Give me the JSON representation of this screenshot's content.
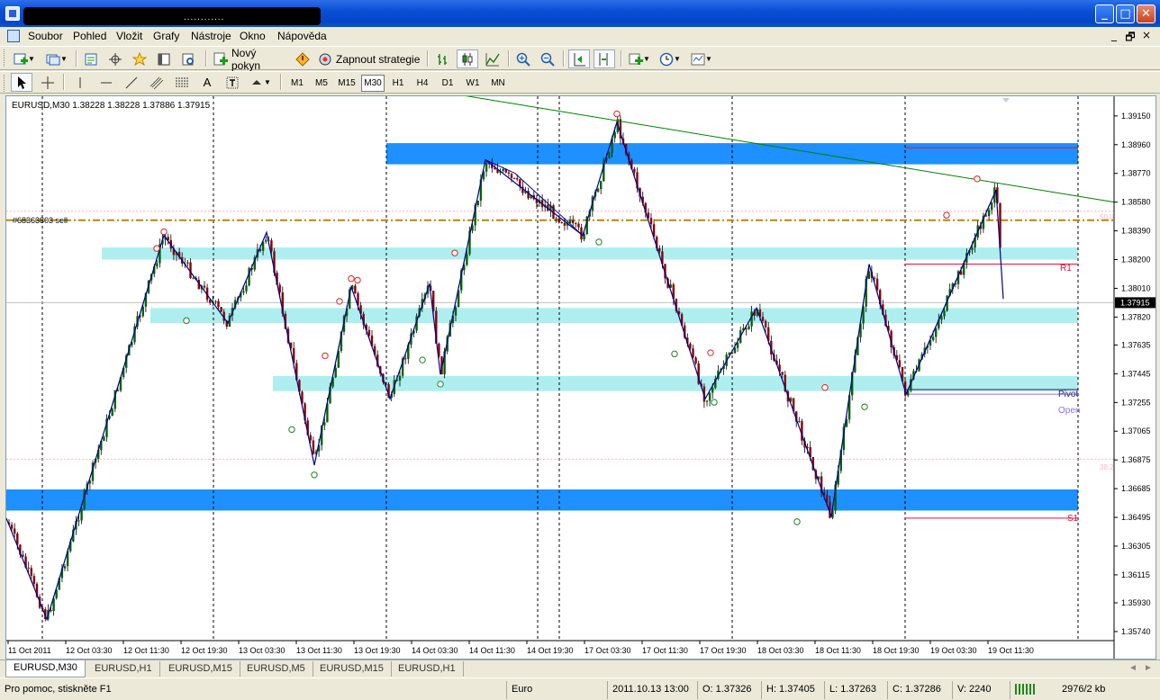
{
  "window": {
    "title_redacted_text": "............",
    "controls": {
      "minimize": "_",
      "maximize": "□",
      "close": "✕"
    }
  },
  "menubar": {
    "items": [
      "Soubor",
      "Pohled",
      "Vložit",
      "Grafy",
      "Nástroje",
      "Okno",
      "Nápověda"
    ],
    "mdi_controls": [
      "_",
      "🗗",
      "×"
    ]
  },
  "toolbar1": {
    "new_order_label": "Nový pokyn",
    "strategy_label": "Zapnout strategie",
    "icons": [
      "new-chart-icon",
      "profiles-icon",
      "market-watch-icon",
      "navigator-icon",
      "favorites-icon",
      "terminal-icon",
      "strategy-tester-icon",
      "new-order-icon",
      "metaeditor-icon",
      "expert-advisors-icon",
      "bar-chart-icon",
      "candlestick-icon",
      "line-chart-icon",
      "zoom-in-icon",
      "zoom-out-icon",
      "autoscroll-icon",
      "chart-shift-icon",
      "indicators-icon",
      "periods-icon",
      "templates-icon"
    ]
  },
  "toolbar2": {
    "tools": [
      "cursor-icon",
      "crosshair-icon",
      "vertical-line-icon",
      "horizontal-line-icon",
      "trendline-icon",
      "equidistant-channel-icon",
      "fibonacci-icon",
      "text-icon",
      "text-label-icon",
      "arrows-icon"
    ],
    "text_tool": "A",
    "timeframes": [
      "M1",
      "M5",
      "M15",
      "M30",
      "H1",
      "H4",
      "D1",
      "W1",
      "MN"
    ],
    "active_timeframe": "M30"
  },
  "chart": {
    "header": "EURUSD,M30  1.38228 1.38228 1.37886 1.37915",
    "order_label": "#68363803 sell",
    "current_price": "1.37915",
    "labels": {
      "r1": "R1",
      "pivot": "Pivot",
      "open": "Open",
      "s1": "S1",
      "fib_50": "50.0",
      "fib_382": "38.2"
    },
    "colors": {
      "bull_candle": "#006400",
      "bear_candle": "#8b0000",
      "zone_dark": "#1e90ff",
      "zone_light": "#afeeee",
      "zigzag": "#00008b",
      "trendline": "#008000",
      "order_line": "#b8860b",
      "resistance": "#dc143c",
      "pivot": "#191970",
      "open": "#9370db",
      "fib": "#ffb6c1"
    }
  },
  "chart_data": {
    "type": "candlestick",
    "symbol": "EURUSD",
    "timeframe": "M30",
    "ohlc_last": {
      "open": 1.38228,
      "high": 1.38228,
      "low": 1.37886,
      "close": 1.37915
    },
    "y_ticks": [
      "1.39150",
      "1.38960",
      "1.38770",
      "1.38580",
      "1.38390",
      "1.38200",
      "1.38010",
      "1.37820",
      "1.37635",
      "1.37445",
      "1.37255",
      "1.37065",
      "1.36875",
      "1.36685",
      "1.36495",
      "1.36305",
      "1.36115",
      "1.35930",
      "1.35740"
    ],
    "y_tick_values": [
      1.3915,
      1.3896,
      1.3877,
      1.3858,
      1.3839,
      1.382,
      1.3801,
      1.3782,
      1.37635,
      1.37445,
      1.37255,
      1.37065,
      1.36875,
      1.36685,
      1.36495,
      1.36305,
      1.36115,
      1.3593,
      1.3574
    ],
    "ylim": [
      1.3568,
      1.3928
    ],
    "x_ticks": [
      "11 Oct 2011",
      "12 Oct 03:30",
      "12 Oct 11:30",
      "12 Oct 19:30",
      "13 Oct 03:30",
      "13 Oct 11:30",
      "13 Oct 19:30",
      "14 Oct 03:30",
      "14 Oct 11:30",
      "14 Oct 19:30",
      "17 Oct 03:30",
      "17 Oct 11:30",
      "17 Oct 19:30",
      "18 Oct 03:30",
      "18 Oct 11:30",
      "18 Oct 19:30",
      "19 Oct 03:30",
      "19 Oct 11:30"
    ],
    "zigzag": [
      {
        "time": "11 Oct 2011",
        "price": 1.3649
      },
      {
        "time": "11 Oct 2011",
        "price": 1.3582
      },
      {
        "time": "12 Oct 11:30",
        "price": 1.3836
      },
      {
        "time": "12 Oct 19:30",
        "price": 1.3778
      },
      {
        "time": "13 Oct 03:30",
        "price": 1.3838
      },
      {
        "time": "13 Oct 11:30",
        "price": 1.3684
      },
      {
        "time": "13 Oct 11:30",
        "price": 1.3802
      },
      {
        "time": "13 Oct 19:30",
        "price": 1.3728
      },
      {
        "time": "14 Oct 03:30",
        "price": 1.3804
      },
      {
        "time": "14 Oct 03:30",
        "price": 1.3744
      },
      {
        "time": "14 Oct 11:30",
        "price": 1.3886
      },
      {
        "time": "14 Oct 19:30",
        "price": 1.3836
      },
      {
        "time": "17 Oct 03:30",
        "price": 1.3911
      },
      {
        "time": "17 Oct 19:30",
        "price": 1.3728
      },
      {
        "time": "18 Oct 03:30",
        "price": 1.3788
      },
      {
        "time": "18 Oct 11:30",
        "price": 1.365
      },
      {
        "time": "18 Oct 19:30",
        "price": 1.3817
      },
      {
        "time": "18 Oct 19:30",
        "price": 1.3731
      },
      {
        "time": "19 Oct 11:30",
        "price": 1.3866
      },
      {
        "time": "19 Oct 11:30",
        "price": 1.3794
      }
    ],
    "levels": [
      {
        "name": "R1",
        "price": 1.3817
      },
      {
        "name": "Pivot",
        "price": 1.3734
      },
      {
        "name": "Open",
        "price": 1.3731
      },
      {
        "name": "S1",
        "price": 1.3649
      },
      {
        "name": "Order #68363803 sell",
        "price": 1.3846
      },
      {
        "name": "50.0",
        "price": 1.3852
      },
      {
        "name": "38.2",
        "price": 1.3688
      }
    ],
    "zones": [
      {
        "from": 1.3883,
        "to": 1.3897,
        "style": "dark"
      },
      {
        "from": 1.382,
        "to": 1.3828,
        "style": "light"
      },
      {
        "from": 1.3778,
        "to": 1.3788,
        "style": "light"
      },
      {
        "from": 1.3733,
        "to": 1.3743,
        "style": "light"
      },
      {
        "from": 1.3654,
        "to": 1.3668,
        "style": "dark"
      }
    ],
    "trendline": [
      {
        "time": "13 Oct 03:30",
        "price": 1.3932
      },
      {
        "time": "19 Oct 11:30",
        "price": 1.3862
      }
    ]
  },
  "tabs": [
    {
      "label": "EURUSD,M30",
      "active": true
    },
    {
      "label": "EURUSD,H1",
      "active": false
    },
    {
      "label": "EURUSD,M15",
      "active": false
    },
    {
      "label": "EURUSD,M5",
      "active": false
    },
    {
      "label": "EURUSD,M15",
      "active": false
    },
    {
      "label": "EURUSD,H1",
      "active": false
    }
  ],
  "statusbar": {
    "help": "Pro pomoc, stiskněte F1",
    "profile": "Euro",
    "datetime": "2011.10.13 13:00",
    "open": "O: 1.37326",
    "high": "H: 1.37405",
    "low": "L: 1.37263",
    "close": "C: 1.37286",
    "volume": "V: 2240",
    "traffic": "2976/2 kb"
  }
}
